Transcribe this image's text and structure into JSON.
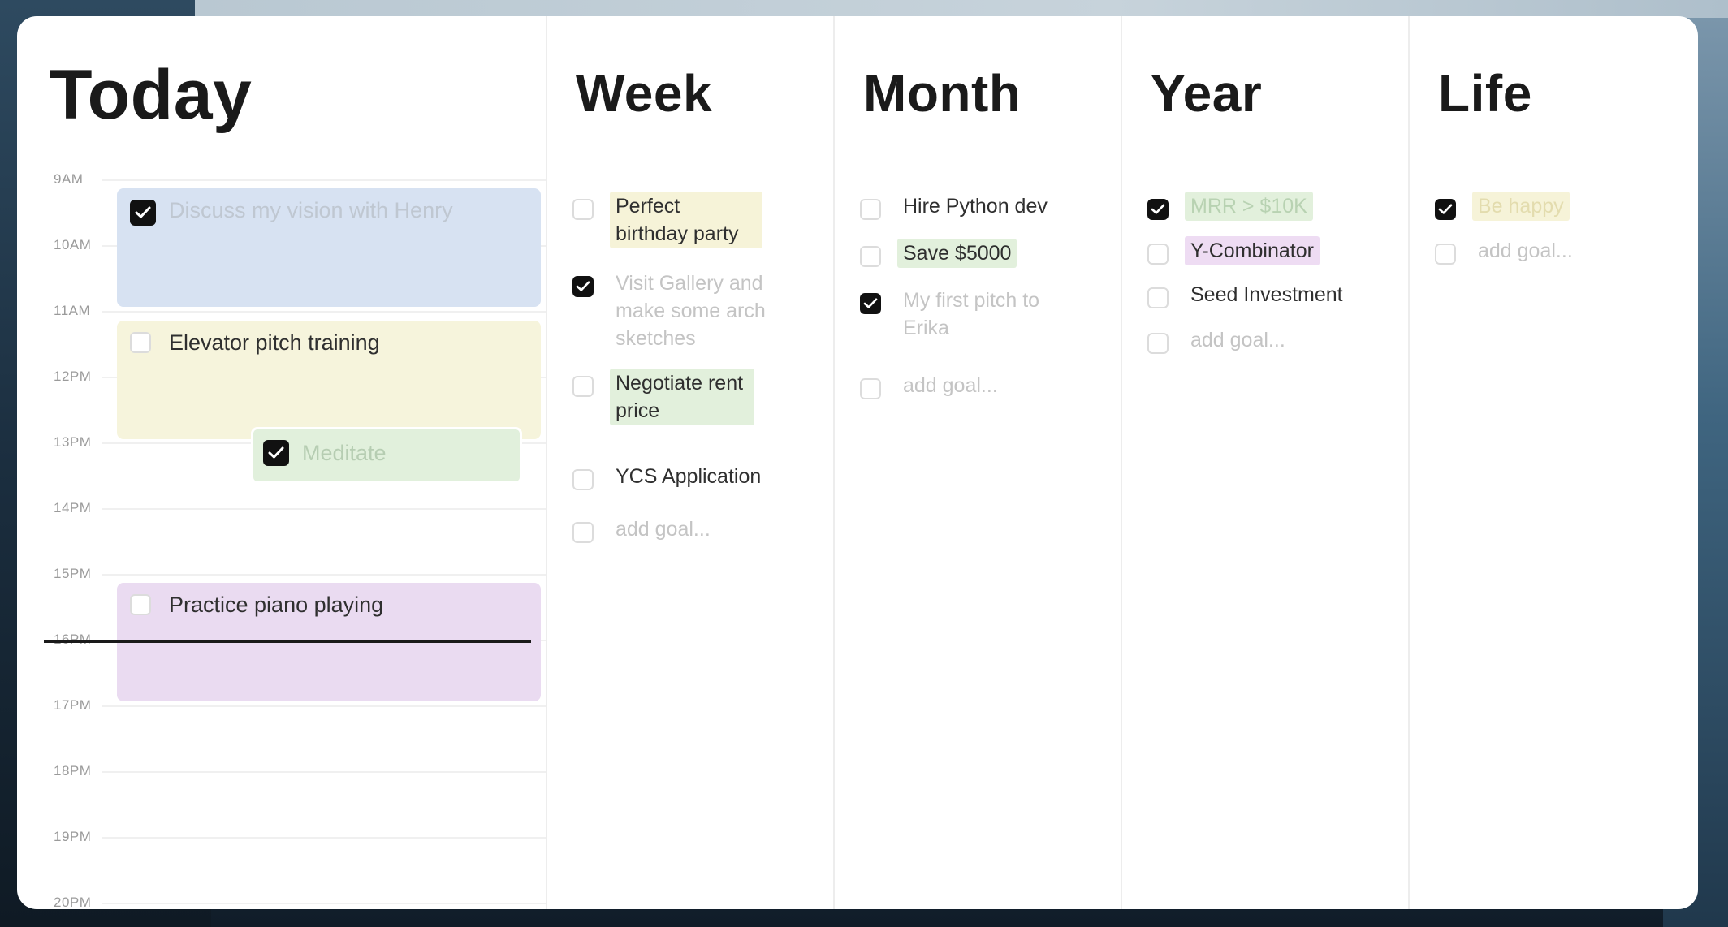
{
  "today": {
    "title": "Today",
    "hours": [
      "9AM",
      "10AM",
      "11AM",
      "12PM",
      "13PM",
      "14PM",
      "15PM",
      "16PM",
      "17PM",
      "18PM",
      "19PM",
      "20PM"
    ],
    "events": [
      {
        "label": "Discuss my vision with Henry",
        "done": true,
        "color": "#d7e2f2"
      },
      {
        "label": "Elevator pitch training",
        "done": false,
        "color": "#f6f4dc"
      },
      {
        "label": "Meditate",
        "done": true,
        "color": "#e1f0dc"
      },
      {
        "label": "Practice piano playing",
        "done": false,
        "color": "#eadbf1"
      }
    ]
  },
  "week": {
    "title": "Week",
    "goals": [
      {
        "label": "Perfect birthday party",
        "done": false,
        "highlight": "#f6f3d8"
      },
      {
        "label": "Visit Gallery and make some arch sketches",
        "done": true
      },
      {
        "label": "Negotiate rent price",
        "done": false,
        "highlight": "#e2f0dc"
      },
      {
        "label": "YCS Application",
        "done": false
      },
      {
        "label": "add goal...",
        "placeholder": true
      }
    ]
  },
  "month": {
    "title": "Month",
    "goals": [
      {
        "label": "Hire Python dev",
        "done": false
      },
      {
        "label": "Save $5000",
        "done": false,
        "highlight": "#e2f0dc"
      },
      {
        "label": "My first pitch to Erika",
        "done": true
      },
      {
        "label": "add goal...",
        "placeholder": true
      }
    ]
  },
  "year": {
    "title": "Year",
    "goals": [
      {
        "label": "MRR > $10K",
        "done": true,
        "highlight": "#e2f0dc"
      },
      {
        "label": "Y-Combinator",
        "done": false,
        "highlight": "#eedcf3"
      },
      {
        "label": "Seed Investment",
        "done": false
      },
      {
        "label": "add goal...",
        "placeholder": true
      }
    ]
  },
  "life": {
    "title": "Life",
    "goals": [
      {
        "label": "Be happy",
        "done": true,
        "highlight": "#f6f3d8"
      },
      {
        "label": "add goal...",
        "placeholder": true
      }
    ]
  }
}
